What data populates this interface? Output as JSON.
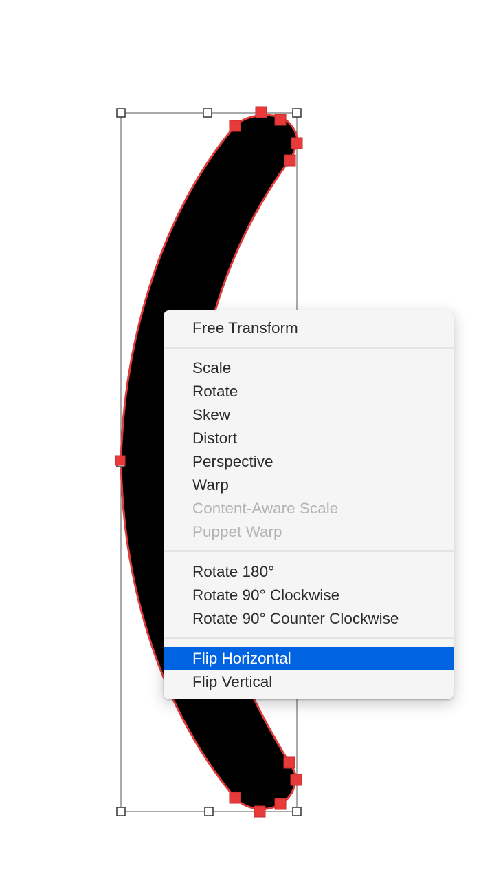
{
  "context_menu": {
    "items": [
      {
        "label": "Free Transform",
        "enabled": true,
        "highlighted": false
      },
      {
        "label": "Scale",
        "enabled": true,
        "highlighted": false
      },
      {
        "label": "Rotate",
        "enabled": true,
        "highlighted": false
      },
      {
        "label": "Skew",
        "enabled": true,
        "highlighted": false
      },
      {
        "label": "Distort",
        "enabled": true,
        "highlighted": false
      },
      {
        "label": "Perspective",
        "enabled": true,
        "highlighted": false
      },
      {
        "label": "Warp",
        "enabled": true,
        "highlighted": false
      },
      {
        "label": "Content-Aware Scale",
        "enabled": false,
        "highlighted": false
      },
      {
        "label": "Puppet Warp",
        "enabled": false,
        "highlighted": false
      },
      {
        "label": "Rotate 180°",
        "enabled": true,
        "highlighted": false
      },
      {
        "label": "Rotate 90° Clockwise",
        "enabled": true,
        "highlighted": false
      },
      {
        "label": "Rotate 90° Counter Clockwise",
        "enabled": true,
        "highlighted": false
      },
      {
        "label": "Flip Horizontal",
        "enabled": true,
        "highlighted": true
      },
      {
        "label": "Flip Vertical",
        "enabled": true,
        "highlighted": false
      }
    ]
  },
  "colors": {
    "shape_fill": "#000000",
    "path_outline": "#e03c3c",
    "anchor_point": "#e83a3a",
    "highlight": "#0063e1",
    "disabled_text": "#b4b4b4"
  }
}
